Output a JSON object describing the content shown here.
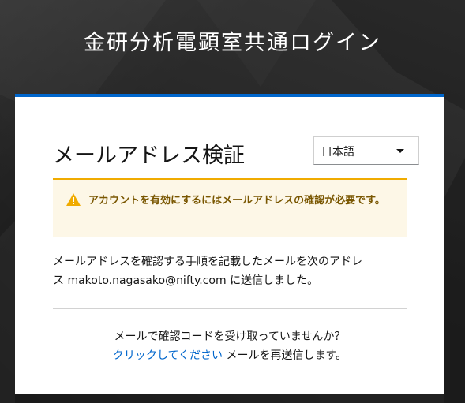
{
  "header": {
    "title": "金研分析電顕室共通ログイン"
  },
  "page": {
    "title": "メールアドレス検証"
  },
  "language": {
    "selected": "日本語"
  },
  "alert": {
    "icon": "warning-icon",
    "color": "#f0ab00",
    "text": "アカウントを有効にするにはメールアドレスの確認が必要です。"
  },
  "info": {
    "line1": "メールアドレスを確認する手順を記載したメールを次のアドレ",
    "line2": "ス makoto.nagasako@nifty.com に送信しました。"
  },
  "resend": {
    "question": "メールで確認コードを受け取っていませんか？",
    "link": "クリックしてください",
    "suffix": " メールを再送信します。"
  },
  "colors": {
    "accent": "#0066cc",
    "background": "#2c2c2c",
    "warning": "#f0ab00"
  }
}
